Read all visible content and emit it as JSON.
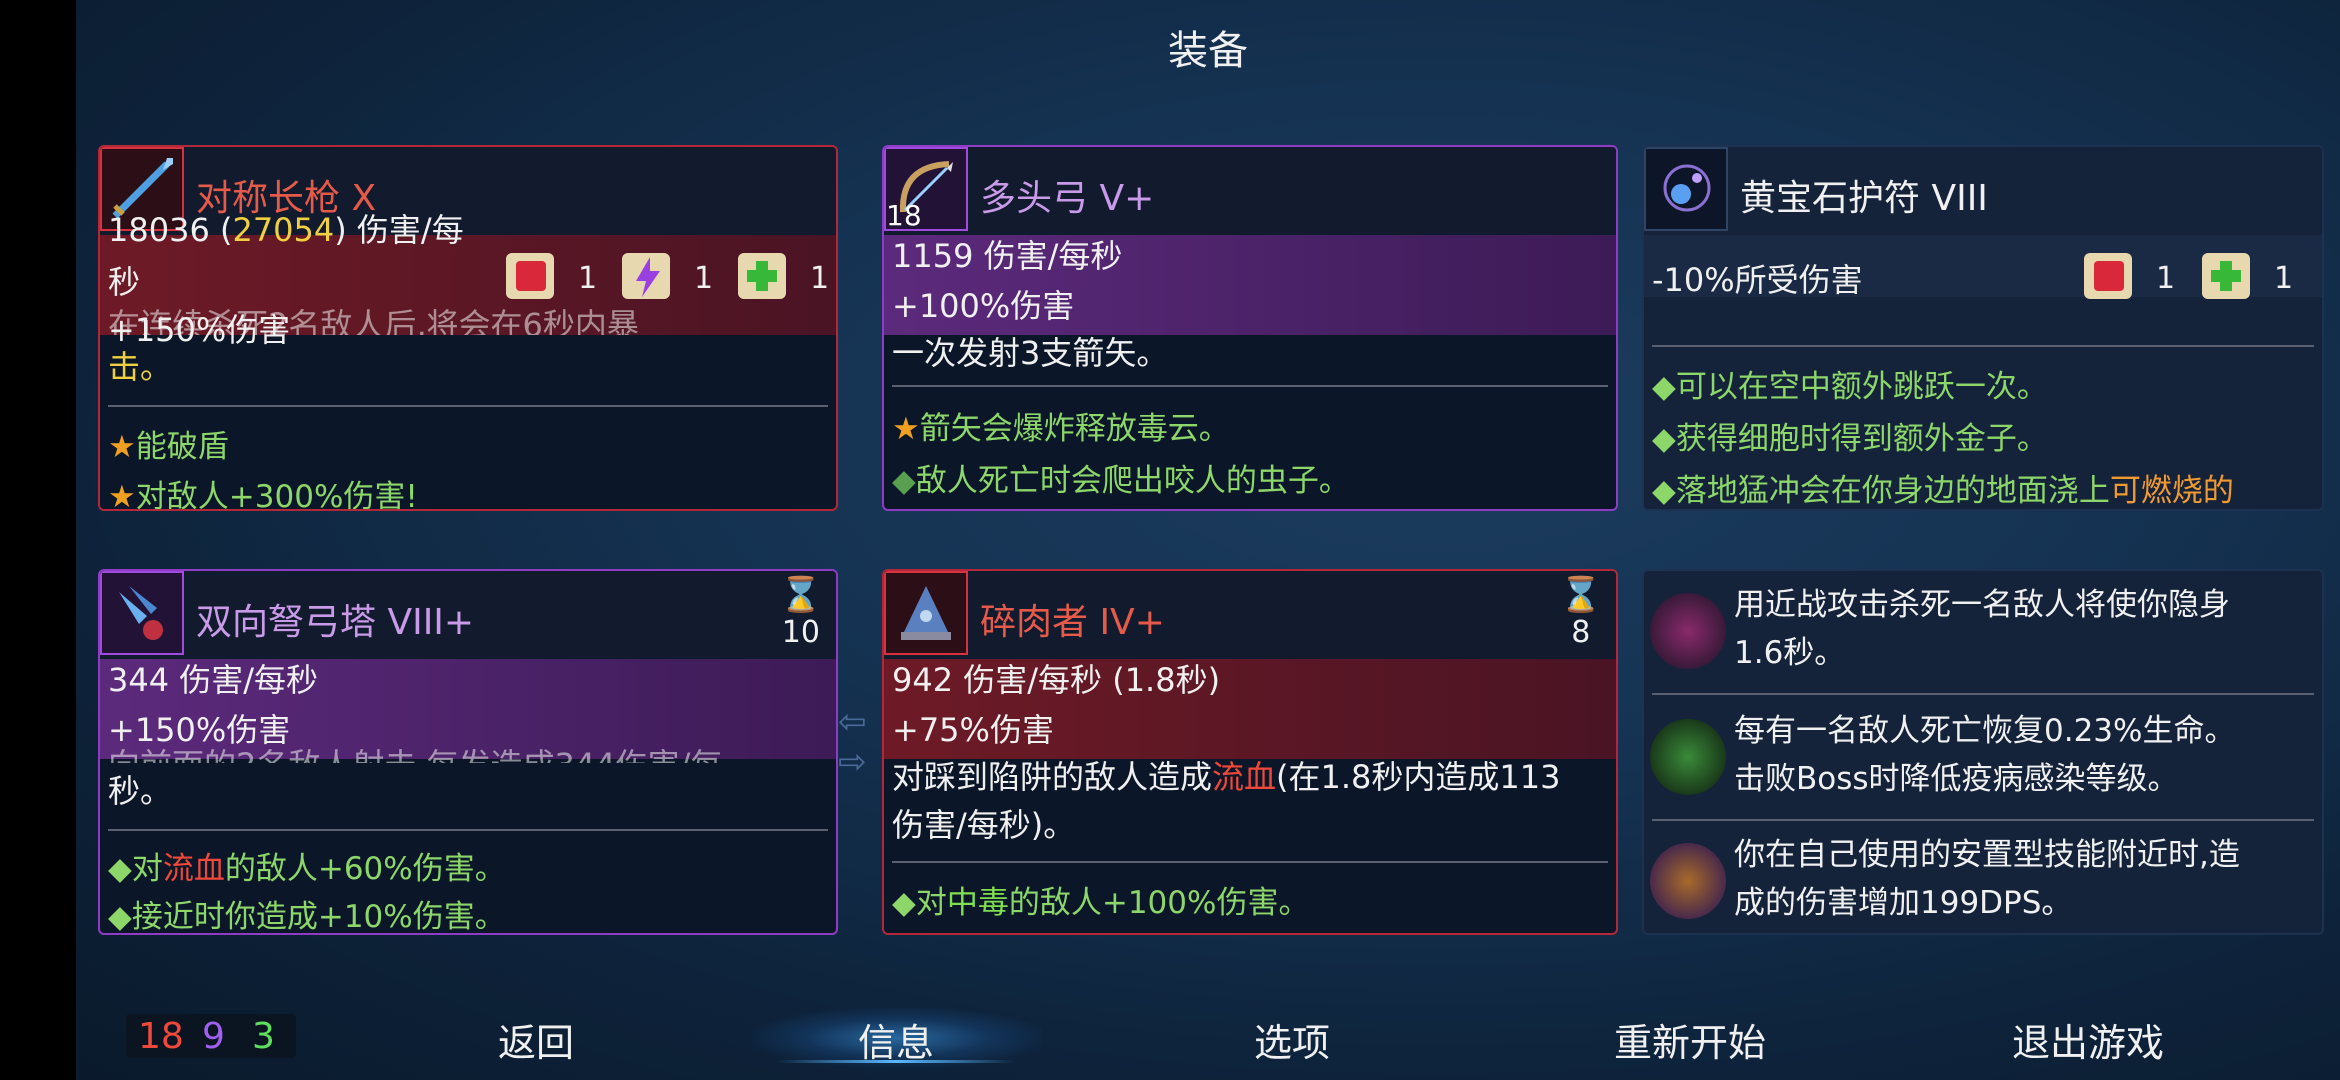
{
  "title": "装备",
  "cards": {
    "c1": {
      "name": "对称长枪 X",
      "dps_base": "18036",
      "dps_boost": "27054",
      "dps_unit": "伤害/每",
      "dps_unit2": "秒",
      "bonus": "+150%伤害",
      "desc_a": "击。",
      "desc_top": "在连续杀死2名敌人后,将会在6秒内暴",
      "bullet1": "能破盾",
      "bullet2": "对敌人+300%伤害!",
      "scrolls": [
        "1",
        "1",
        "1"
      ]
    },
    "c2": {
      "name": "多头弓 V+",
      "level": "18",
      "dps": "1159 伤害/每秒",
      "bonus": "+100%伤害",
      "desc": "一次发射3支箭矢。",
      "bullet1": "箭矢会爆炸释放毒云。",
      "bullet2": "敌人死亡时会爬出咬人的虫子。"
    },
    "c3": {
      "name": "黄宝石护符 VIII",
      "stat": "-10%所受伤害",
      "scrolls": [
        "1",
        "1"
      ],
      "bullet1": "可以在空中额外跳跃一次。",
      "bullet2": "获得细胞时得到额外金子。",
      "bullet3_a": "落地猛冲会在你身边的地面浇上",
      "bullet3_b": "可燃烧的"
    },
    "c4": {
      "name": "双向弩弓塔 VIII+",
      "timer": "10",
      "dps": "344 伤害/每秒",
      "bonus": "+150%伤害",
      "desc_top": "向前面的2名敌人射击,每发造成344伤害/每",
      "desc": "秒。",
      "bullet1_a": "对",
      "bullet1_b": "流血",
      "bullet1_c": "的敌人+60%伤害。",
      "bullet2": "接近时你造成+10%伤害。"
    },
    "c5": {
      "name": "碎肉者 IV+",
      "timer": "8",
      "dps": "942 伤害/每秒 (1.8秒)",
      "bonus": "+75%伤害",
      "desc_a": "对踩到陷阱的敌人造成",
      "desc_b": "流血",
      "desc_c": "(在1.8秒内造成113",
      "desc_d": "伤害/每秒)。",
      "bullet1_a": "对",
      "bullet1_b": "中毒",
      "bullet1_c": "的敌人+100%伤害。"
    },
    "c6": {
      "m1": "用近战攻击杀死一名敌人将使你隐身1.6秒。",
      "m1a": "用近战攻击杀死一名敌人将使你隐身",
      "m1b": "1.6秒。",
      "m2a": "每有一名敌人死亡恢复0.23%生命。",
      "m2b": "击败Boss时降低疫病感染等级。",
      "m3a": "你在自己使用的安置型技能附近时,造",
      "m3b": "成的伤害增加199DPS。"
    }
  },
  "stats": {
    "red": "18",
    "purple": "9",
    "green": "3"
  },
  "nav": {
    "back": "返回",
    "info": "信息",
    "options": "选项",
    "restart": "重新开始",
    "quit": "退出游戏"
  },
  "colors": {
    "red": "#f0483a",
    "purple": "#a060f0",
    "green": "#5ee05e",
    "accent": "#5ab8ff"
  }
}
